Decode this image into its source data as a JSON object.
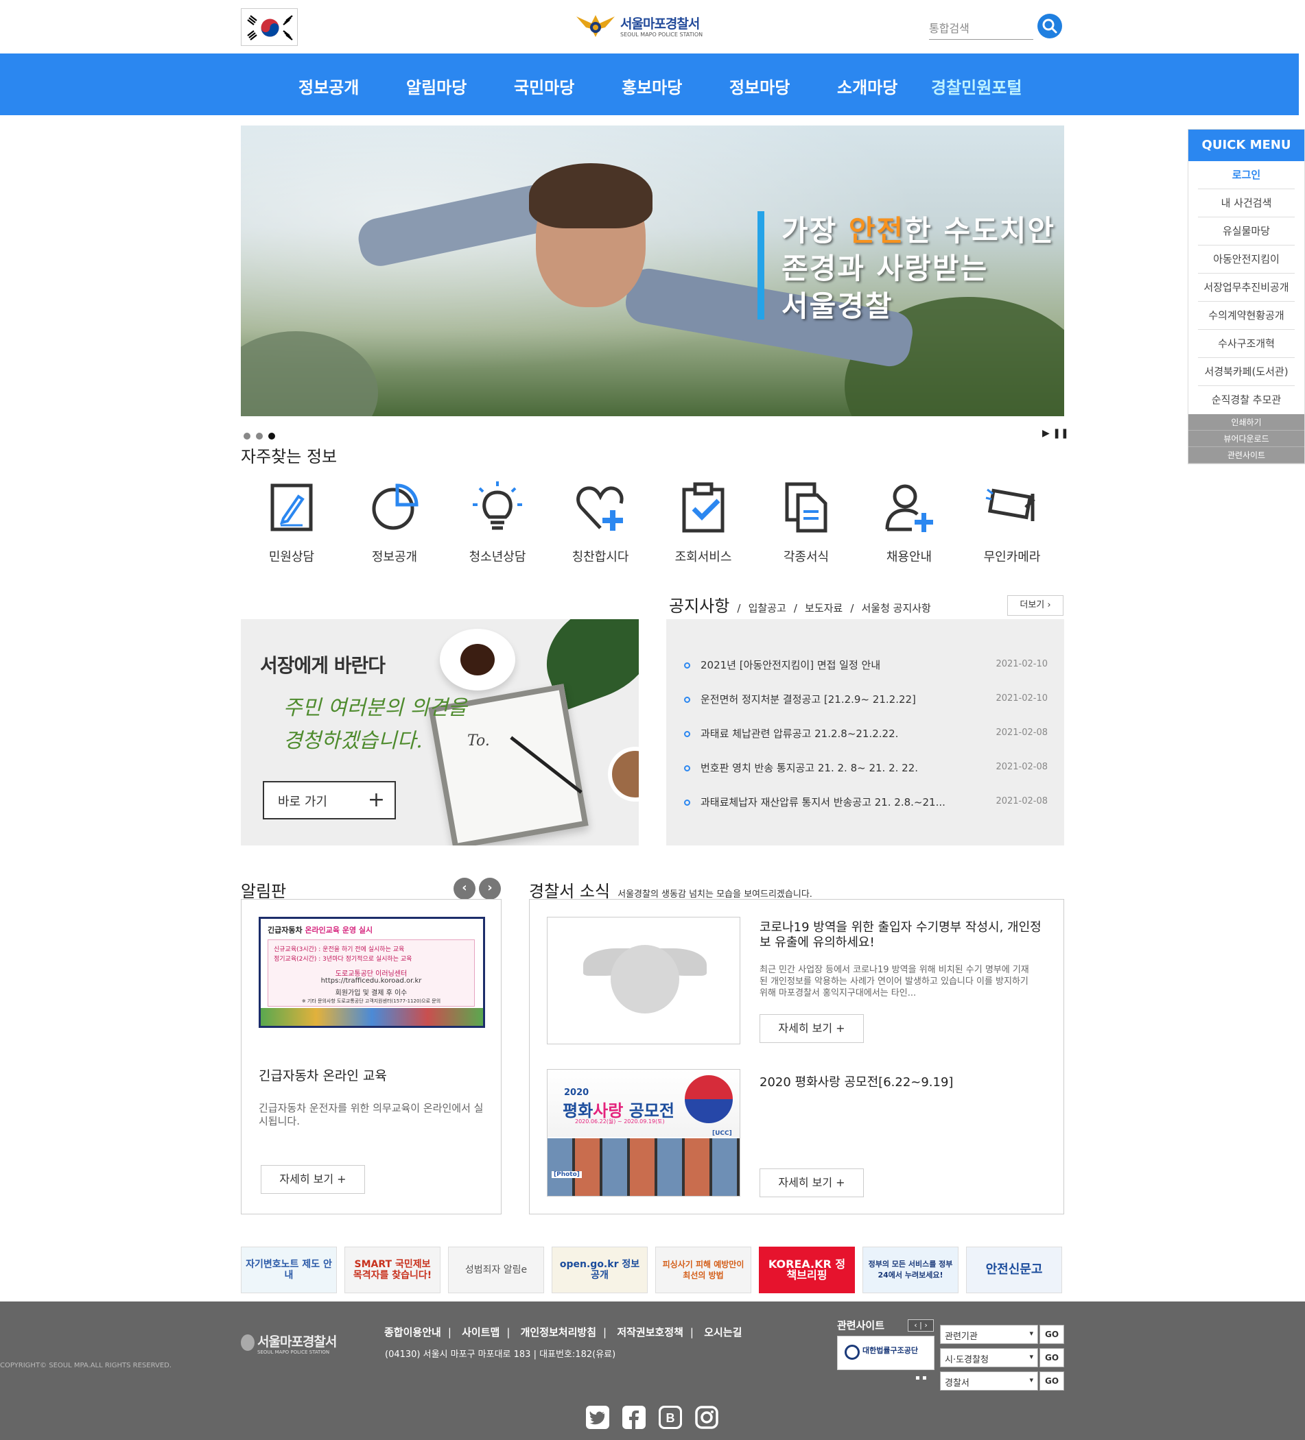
{
  "header": {
    "logo_ko": "서울마포경찰서",
    "logo_en": "SEOUL MAPO POLICE STATION",
    "search_placeholder": "통합검색"
  },
  "nav": [
    "정보공개",
    "알림마당",
    "국민마당",
    "홍보마당",
    "정보마당",
    "소개마당",
    "경찰민원포털"
  ],
  "banner": {
    "line1_a": "가장 ",
    "line1_hl": "안전",
    "line1_b": "한 수도치안",
    "line2": "존경과 사랑받는",
    "line3": "서울경찰",
    "slides": 3,
    "active_slide": 3
  },
  "frequent": {
    "title": "자주찾는 정보",
    "items": [
      "민원상담",
      "정보공개",
      "청소년상담",
      "칭찬합시다",
      "조회서비스",
      "각종서식",
      "채용안내",
      "무인카메라"
    ]
  },
  "quick_menu": {
    "title": "QUICK MENU",
    "items": [
      "로그인",
      "내 사건검색",
      "유실물마당",
      "아동안전지킴이",
      "서장업무추진비공개",
      "수의계약현황공개",
      "수사구조개혁",
      "서경북카페(도서관)",
      "순직경찰 추모관"
    ],
    "sub_items": [
      "인쇄하기",
      "뷰어다운로드",
      "관련사이트"
    ]
  },
  "chief": {
    "title": "서장에게 바란다",
    "hand_line1": "주민 여러분의 의견을",
    "hand_line2": "경청하겠습니다.",
    "button": "바로 가기",
    "paper_text": "To."
  },
  "notice": {
    "title": "공지사항",
    "tabs": [
      "입찰공고",
      "보도자료",
      "서울청 공지사항"
    ],
    "more": "더보기",
    "items": [
      {
        "text": "2021년 [아동안전지킴이] 면접 일정 안내",
        "date": "2021-02-10"
      },
      {
        "text": "운전면허 정지처분 결정공고 [21.2.9~ 21.2.22]",
        "date": "2021-02-10"
      },
      {
        "text": "과태료 체납관련 압류공고 21.2.8~21.2.22.",
        "date": "2021-02-08"
      },
      {
        "text": "번호판 영치 반송 통지공고 21. 2. 8~ 21. 2. 22.",
        "date": "2021-02-08"
      },
      {
        "text": "과태료체납자 재산압류 통지서 반송공고 21. 2.8.~21...",
        "date": "2021-02-08"
      }
    ]
  },
  "board": {
    "title": "알림판",
    "img_title_a": "긴급자동차 ",
    "img_title_b": "온라인교육 운영 실시",
    "img_line1": "신규교육(3시간) : 운전을 하기 전에 실시하는 교육",
    "img_line2": "정기교육(2시간) : 3년마다 정기적으로 실시하는 교육",
    "img_line3": "도로교통공단 이러닝센터",
    "img_line4": "https://trafficedu.koroad.or.kr",
    "img_line5": "회원가입 및 결제 후 이수",
    "img_line6": "※ 기타 문의사항 도로교통공단 고객지원센터(1577-1120)으로 문의",
    "caption": "긴급자동차 온라인 교육",
    "desc": "긴급자동차 운전자를 위한 의무교육이 온라인에서 실시됩니다.",
    "more": "자세히 보기 +"
  },
  "news": {
    "title": "경찰서 소식",
    "subtitle": "서울경찰의 생동감 넘치는 모습을 보여드리겠습니다.",
    "items": [
      {
        "title": "코로나19 방역을 위한 출입자 수기명부 작성시, 개인정보 유출에 유의하세요!",
        "desc": "최근 민간 사업장 등에서 코로나19 방역을 위해 비치된 수기 명부에 기재된 개인정보를 악용하는 사례가 연이어 발생하고 있습니다 이를 방지하기 위해 마포경찰서 홍익지구대에서는 타인...",
        "more": "자세히 보기 +"
      },
      {
        "title": "2020 평화사랑 공모전[6.22~9.19]",
        "more": "자세히 보기 +",
        "img_year": "2020",
        "img_title_a": "평화",
        "img_title_b": "사랑",
        "img_title_c": " 공모전",
        "img_dates": "2020.06.22(월) ~ 2020.09.19(토)",
        "img_ucc": "[UCC]",
        "img_photo": "[Photo]"
      }
    ]
  },
  "link_banners": [
    "자기변호노트 제도 안내",
    "SMART 국민제보 목격자를 찾습니다!",
    "성범죄자 알림e",
    "open.go.kr 정보공개",
    "피싱사기 피해 예방만이 최선의 방법",
    "KOREA.KR 정책브리핑",
    "정부의 모든 서비스를 정부24에서 누려보세요!",
    "안전신문고"
  ],
  "footer": {
    "logo_ko": "서울마포경찰서",
    "logo_en": "SEOUL MAPO POLICE STATION",
    "links": [
      "종합이용안내",
      "사이트맵",
      "개인정보처리방침",
      "저작권보호정책",
      "오시는길"
    ],
    "address": "(04130) 서울시 마포구 마포대로 183  |  대표번호:182(유료)",
    "copyright": "COPYRIGHT© SEOUL MPA.ALL RIGHTS RESERVED.",
    "related_title": "관련사이트",
    "related_logo": "대한법률구조공단",
    "selects": [
      "관련기관",
      "시·도경찰청",
      "경찰서"
    ],
    "go": "GO",
    "sns": [
      "twitter-icon",
      "facebook-icon",
      "blog-icon",
      "instagram-icon"
    ]
  },
  "colors": {
    "primary": "#2b87f0",
    "highlight": "#f7921e",
    "footer": "#666666"
  }
}
